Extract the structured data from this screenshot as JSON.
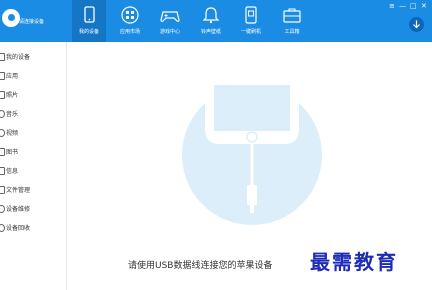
{
  "header": {
    "connect_label": "请连接设备",
    "nav": [
      {
        "label": "我的设备",
        "icon": "phone-icon",
        "active": true
      },
      {
        "label": "应用市场",
        "icon": "apps-icon",
        "active": false
      },
      {
        "label": "游戏中心",
        "icon": "gamepad-icon",
        "active": false
      },
      {
        "label": "铃声壁纸",
        "icon": "bell-icon",
        "active": false
      },
      {
        "label": "一键刷机",
        "icon": "flash-icon",
        "active": false
      },
      {
        "label": "工具箱",
        "icon": "toolbox-icon",
        "active": false
      }
    ],
    "window_controls": [
      "≡",
      "—",
      "□",
      "✕"
    ]
  },
  "sidebar": {
    "items": [
      {
        "label": "我的设备"
      },
      {
        "label": "应用"
      },
      {
        "label": "照片"
      },
      {
        "label": "音乐"
      },
      {
        "label": "视频"
      },
      {
        "label": "图书"
      },
      {
        "label": "信息"
      },
      {
        "label": "文件管理"
      },
      {
        "label": "设备维修"
      },
      {
        "label": "设备回收"
      }
    ]
  },
  "main": {
    "message": "请使用USB数据线连接您的苹果设备",
    "watermark": "最需教育"
  },
  "colors": {
    "accent": "#1b8ce3",
    "active_tab": "#1576c6",
    "illustration": "#dceefa"
  }
}
